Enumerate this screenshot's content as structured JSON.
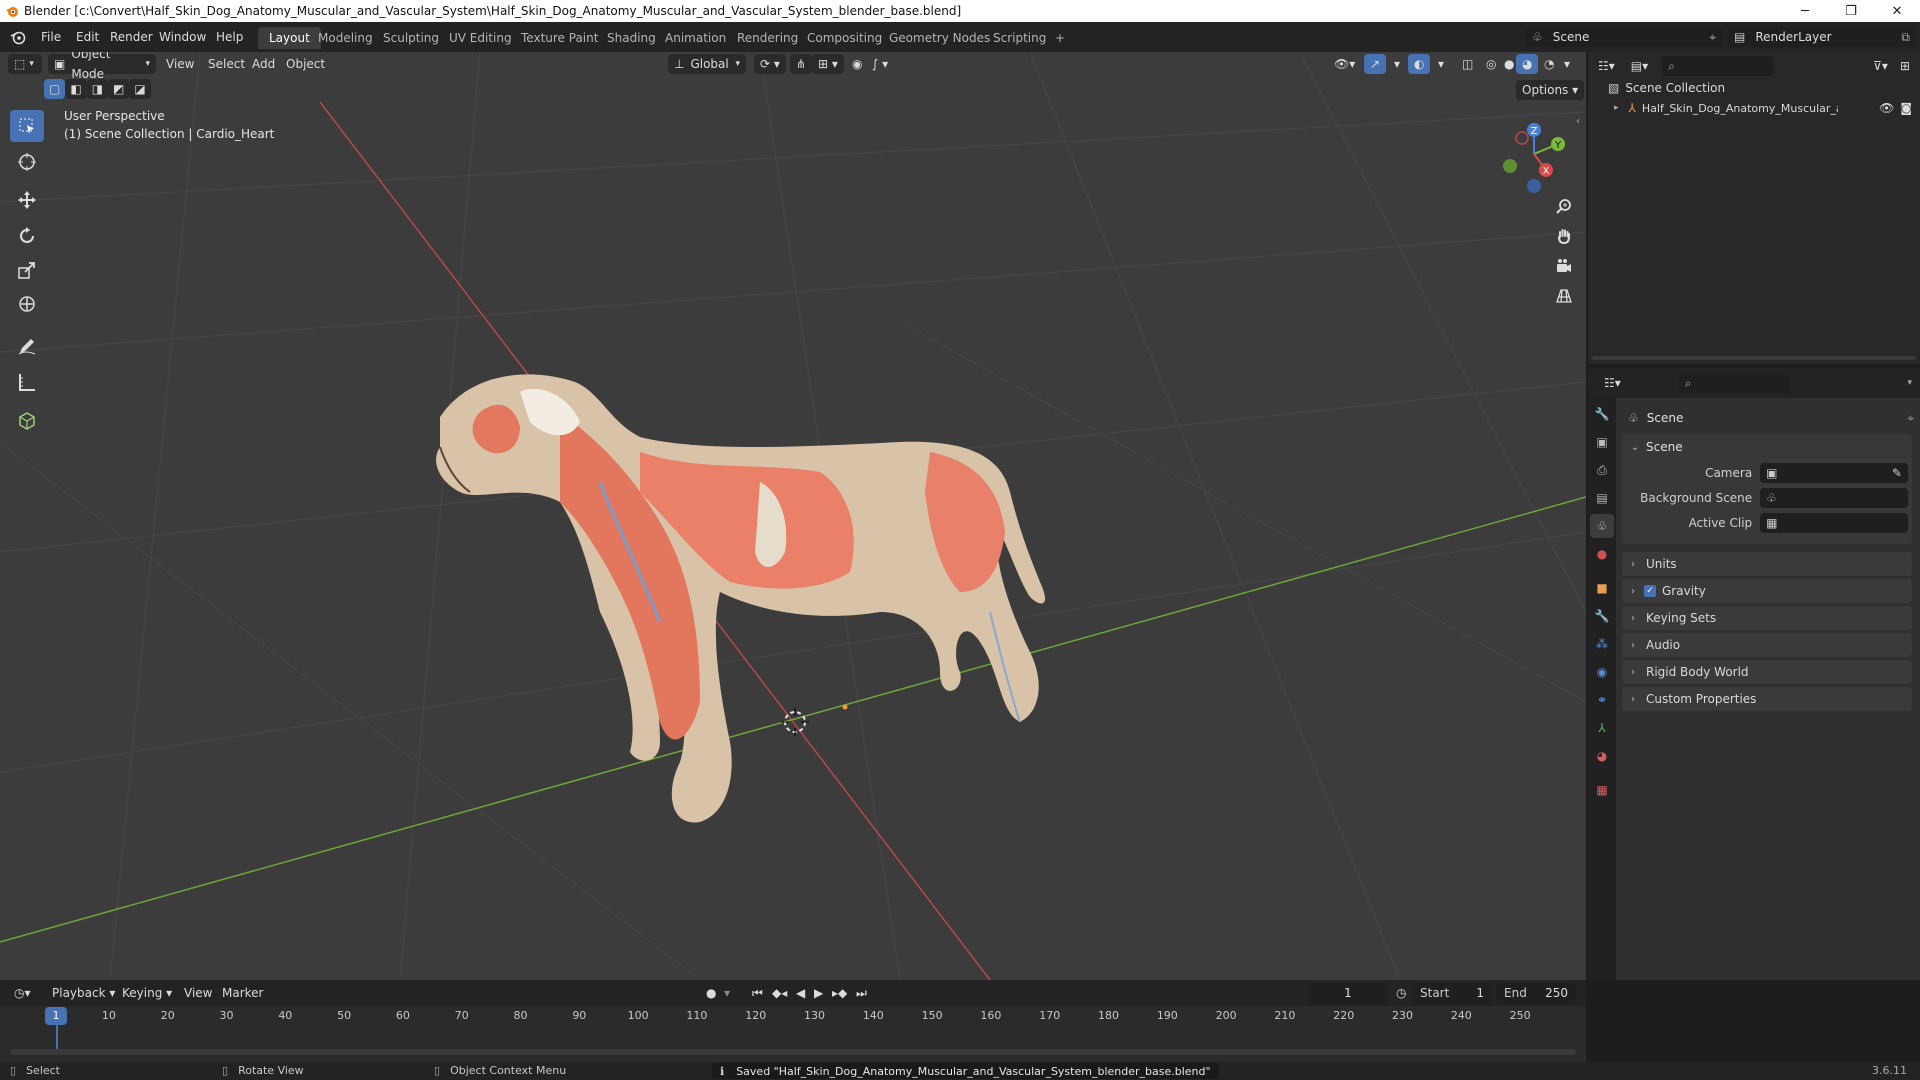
{
  "titlebar": {
    "title": "Blender [c:\\Convert\\Half_Skin_Dog_Anatomy_Muscular_and_Vascular_System\\Half_Skin_Dog_Anatomy_Muscular_and_Vascular_System_blender_base.blend]",
    "minimize": "─",
    "restore": "❐",
    "close": "✕"
  },
  "menu": [
    "File",
    "Edit",
    "Render",
    "Window",
    "Help"
  ],
  "workspaces": [
    "Layout",
    "Modeling",
    "Sculpting",
    "UV Editing",
    "Texture Paint",
    "Shading",
    "Animation",
    "Rendering",
    "Compositing",
    "Geometry Nodes",
    "Scripting",
    "+"
  ],
  "active_workspace": "Layout",
  "scene_selector": "Scene",
  "view_layer": "RenderLayer",
  "viewport": {
    "mode": "Object Mode",
    "header_menus": [
      "View",
      "Select",
      "Add",
      "Object"
    ],
    "orientation": "Global",
    "options": "Options",
    "overlay_title": "User Perspective",
    "overlay_sub": "(1) Scene Collection | Cardio_Heart",
    "gizmo": {
      "x": "X",
      "y": "Y",
      "z": "Z"
    }
  },
  "outliner": {
    "root": "Scene Collection",
    "items": [
      {
        "label": "Half_Skin_Dog_Anatomy_Muscular_and_"
      }
    ]
  },
  "properties": {
    "context": "Scene",
    "section": "Scene",
    "fields": [
      {
        "label": "Camera"
      },
      {
        "label": "Background Scene"
      },
      {
        "label": "Active Clip"
      }
    ],
    "panels": [
      "Units",
      "Gravity",
      "Keying Sets",
      "Audio",
      "Rigid Body World",
      "Custom Properties"
    ],
    "gravity_checked": true
  },
  "timeline": {
    "menus": [
      "Playback",
      "Keying",
      "View",
      "Marker"
    ],
    "current_frame": "1",
    "start_label": "Start",
    "start": "1",
    "end_label": "End",
    "end": "250",
    "ticks": [
      "10",
      "20",
      "30",
      "40",
      "50",
      "60",
      "70",
      "80",
      "90",
      "100",
      "110",
      "120",
      "130",
      "140",
      "150",
      "160",
      "170",
      "180",
      "190",
      "200",
      "210",
      "220",
      "230",
      "240",
      "250"
    ],
    "playhead": "1"
  },
  "status": {
    "select": "Select",
    "rotate": "Rotate View",
    "context_menu": "Object Context Menu",
    "message": "Saved \"Half_Skin_Dog_Anatomy_Muscular_and_Vascular_System_blender_base.blend\"",
    "version": "3.6.11"
  },
  "colors": {
    "accent": "#4772b3",
    "x_axis": "#d84a4a",
    "y_axis": "#7ab93a",
    "z_axis": "#4b7fd6",
    "muscle": "#e87a62",
    "skin": "#d8c0a6"
  }
}
